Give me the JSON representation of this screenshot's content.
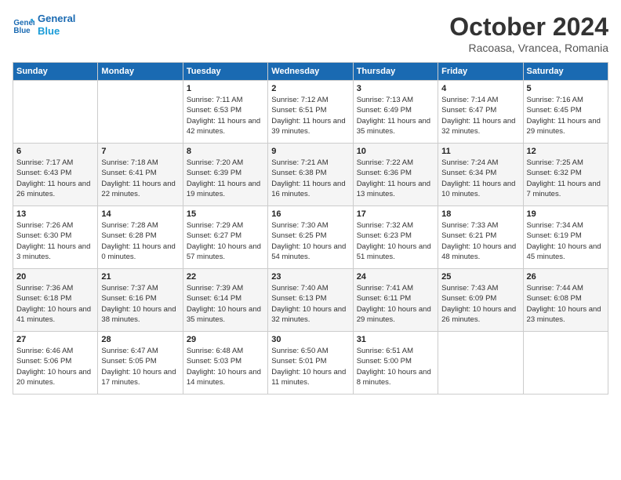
{
  "logo": {
    "line1": "General",
    "line2": "Blue"
  },
  "title": "October 2024",
  "location": "Racoasa, Vrancea, Romania",
  "days_of_week": [
    "Sunday",
    "Monday",
    "Tuesday",
    "Wednesday",
    "Thursday",
    "Friday",
    "Saturday"
  ],
  "weeks": [
    [
      {
        "day": "",
        "sunrise": "",
        "sunset": "",
        "daylight": ""
      },
      {
        "day": "",
        "sunrise": "",
        "sunset": "",
        "daylight": ""
      },
      {
        "day": "1",
        "sunrise": "Sunrise: 7:11 AM",
        "sunset": "Sunset: 6:53 PM",
        "daylight": "Daylight: 11 hours and 42 minutes."
      },
      {
        "day": "2",
        "sunrise": "Sunrise: 7:12 AM",
        "sunset": "Sunset: 6:51 PM",
        "daylight": "Daylight: 11 hours and 39 minutes."
      },
      {
        "day": "3",
        "sunrise": "Sunrise: 7:13 AM",
        "sunset": "Sunset: 6:49 PM",
        "daylight": "Daylight: 11 hours and 35 minutes."
      },
      {
        "day": "4",
        "sunrise": "Sunrise: 7:14 AM",
        "sunset": "Sunset: 6:47 PM",
        "daylight": "Daylight: 11 hours and 32 minutes."
      },
      {
        "day": "5",
        "sunrise": "Sunrise: 7:16 AM",
        "sunset": "Sunset: 6:45 PM",
        "daylight": "Daylight: 11 hours and 29 minutes."
      }
    ],
    [
      {
        "day": "6",
        "sunrise": "Sunrise: 7:17 AM",
        "sunset": "Sunset: 6:43 PM",
        "daylight": "Daylight: 11 hours and 26 minutes."
      },
      {
        "day": "7",
        "sunrise": "Sunrise: 7:18 AM",
        "sunset": "Sunset: 6:41 PM",
        "daylight": "Daylight: 11 hours and 22 minutes."
      },
      {
        "day": "8",
        "sunrise": "Sunrise: 7:20 AM",
        "sunset": "Sunset: 6:39 PM",
        "daylight": "Daylight: 11 hours and 19 minutes."
      },
      {
        "day": "9",
        "sunrise": "Sunrise: 7:21 AM",
        "sunset": "Sunset: 6:38 PM",
        "daylight": "Daylight: 11 hours and 16 minutes."
      },
      {
        "day": "10",
        "sunrise": "Sunrise: 7:22 AM",
        "sunset": "Sunset: 6:36 PM",
        "daylight": "Daylight: 11 hours and 13 minutes."
      },
      {
        "day": "11",
        "sunrise": "Sunrise: 7:24 AM",
        "sunset": "Sunset: 6:34 PM",
        "daylight": "Daylight: 11 hours and 10 minutes."
      },
      {
        "day": "12",
        "sunrise": "Sunrise: 7:25 AM",
        "sunset": "Sunset: 6:32 PM",
        "daylight": "Daylight: 11 hours and 7 minutes."
      }
    ],
    [
      {
        "day": "13",
        "sunrise": "Sunrise: 7:26 AM",
        "sunset": "Sunset: 6:30 PM",
        "daylight": "Daylight: 11 hours and 3 minutes."
      },
      {
        "day": "14",
        "sunrise": "Sunrise: 7:28 AM",
        "sunset": "Sunset: 6:28 PM",
        "daylight": "Daylight: 11 hours and 0 minutes."
      },
      {
        "day": "15",
        "sunrise": "Sunrise: 7:29 AM",
        "sunset": "Sunset: 6:27 PM",
        "daylight": "Daylight: 10 hours and 57 minutes."
      },
      {
        "day": "16",
        "sunrise": "Sunrise: 7:30 AM",
        "sunset": "Sunset: 6:25 PM",
        "daylight": "Daylight: 10 hours and 54 minutes."
      },
      {
        "day": "17",
        "sunrise": "Sunrise: 7:32 AM",
        "sunset": "Sunset: 6:23 PM",
        "daylight": "Daylight: 10 hours and 51 minutes."
      },
      {
        "day": "18",
        "sunrise": "Sunrise: 7:33 AM",
        "sunset": "Sunset: 6:21 PM",
        "daylight": "Daylight: 10 hours and 48 minutes."
      },
      {
        "day": "19",
        "sunrise": "Sunrise: 7:34 AM",
        "sunset": "Sunset: 6:19 PM",
        "daylight": "Daylight: 10 hours and 45 minutes."
      }
    ],
    [
      {
        "day": "20",
        "sunrise": "Sunrise: 7:36 AM",
        "sunset": "Sunset: 6:18 PM",
        "daylight": "Daylight: 10 hours and 41 minutes."
      },
      {
        "day": "21",
        "sunrise": "Sunrise: 7:37 AM",
        "sunset": "Sunset: 6:16 PM",
        "daylight": "Daylight: 10 hours and 38 minutes."
      },
      {
        "day": "22",
        "sunrise": "Sunrise: 7:39 AM",
        "sunset": "Sunset: 6:14 PM",
        "daylight": "Daylight: 10 hours and 35 minutes."
      },
      {
        "day": "23",
        "sunrise": "Sunrise: 7:40 AM",
        "sunset": "Sunset: 6:13 PM",
        "daylight": "Daylight: 10 hours and 32 minutes."
      },
      {
        "day": "24",
        "sunrise": "Sunrise: 7:41 AM",
        "sunset": "Sunset: 6:11 PM",
        "daylight": "Daylight: 10 hours and 29 minutes."
      },
      {
        "day": "25",
        "sunrise": "Sunrise: 7:43 AM",
        "sunset": "Sunset: 6:09 PM",
        "daylight": "Daylight: 10 hours and 26 minutes."
      },
      {
        "day": "26",
        "sunrise": "Sunrise: 7:44 AM",
        "sunset": "Sunset: 6:08 PM",
        "daylight": "Daylight: 10 hours and 23 minutes."
      }
    ],
    [
      {
        "day": "27",
        "sunrise": "Sunrise: 6:46 AM",
        "sunset": "Sunset: 5:06 PM",
        "daylight": "Daylight: 10 hours and 20 minutes."
      },
      {
        "day": "28",
        "sunrise": "Sunrise: 6:47 AM",
        "sunset": "Sunset: 5:05 PM",
        "daylight": "Daylight: 10 hours and 17 minutes."
      },
      {
        "day": "29",
        "sunrise": "Sunrise: 6:48 AM",
        "sunset": "Sunset: 5:03 PM",
        "daylight": "Daylight: 10 hours and 14 minutes."
      },
      {
        "day": "30",
        "sunrise": "Sunrise: 6:50 AM",
        "sunset": "Sunset: 5:01 PM",
        "daylight": "Daylight: 10 hours and 11 minutes."
      },
      {
        "day": "31",
        "sunrise": "Sunrise: 6:51 AM",
        "sunset": "Sunset: 5:00 PM",
        "daylight": "Daylight: 10 hours and 8 minutes."
      },
      {
        "day": "",
        "sunrise": "",
        "sunset": "",
        "daylight": ""
      },
      {
        "day": "",
        "sunrise": "",
        "sunset": "",
        "daylight": ""
      }
    ]
  ]
}
